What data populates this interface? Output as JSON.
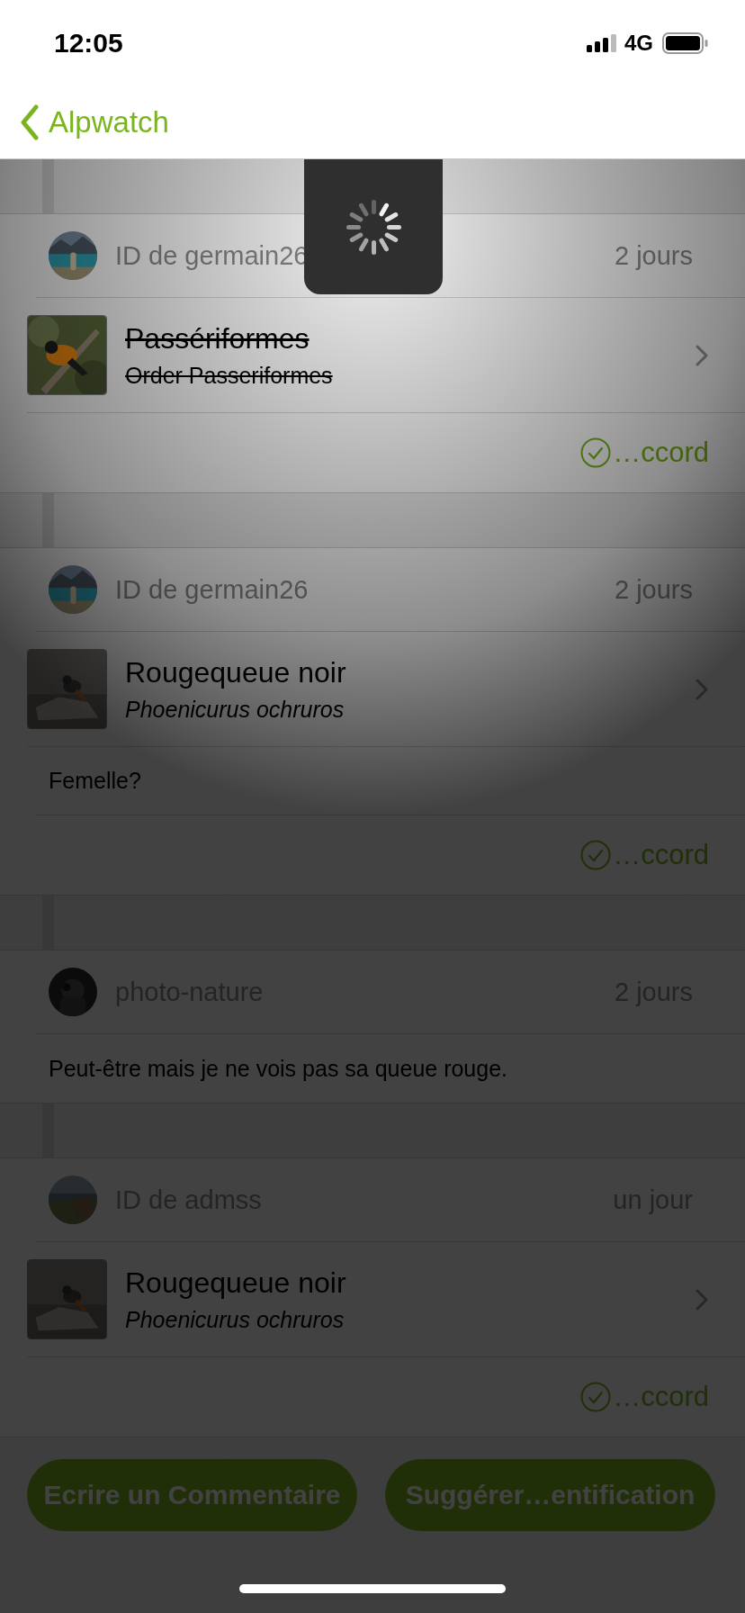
{
  "status_bar": {
    "time": "12:05",
    "network": "4G"
  },
  "nav": {
    "back_label": "Alpwatch"
  },
  "activity": [
    {
      "kind": "identification",
      "user": "ID de germain26",
      "age": "2 jours",
      "taxon": {
        "name": "Passériformes",
        "scientific": "Order Passeriformes",
        "withdrawn": true
      },
      "agree": "…ccord"
    },
    {
      "kind": "identification",
      "user": "ID de germain26",
      "age": "2 jours",
      "taxon": {
        "name": "Rougequeue noir",
        "scientific": "Phoenicurus ochruros",
        "withdrawn": false
      },
      "comment": "Femelle?",
      "agree": "…ccord"
    },
    {
      "kind": "comment",
      "user": "photo-nature",
      "age": "2 jours",
      "comment": "Peut-être mais je ne vois pas sa queue rouge."
    },
    {
      "kind": "identification",
      "user": "ID de admss",
      "age": "un jour",
      "taxon": {
        "name": "Rougequeue noir",
        "scientific": "Phoenicurus ochruros",
        "withdrawn": false
      },
      "agree": "…ccord"
    }
  ],
  "actions": [
    "Ecrire un Commentaire",
    "Suggérer…entification"
  ],
  "loading": true
}
